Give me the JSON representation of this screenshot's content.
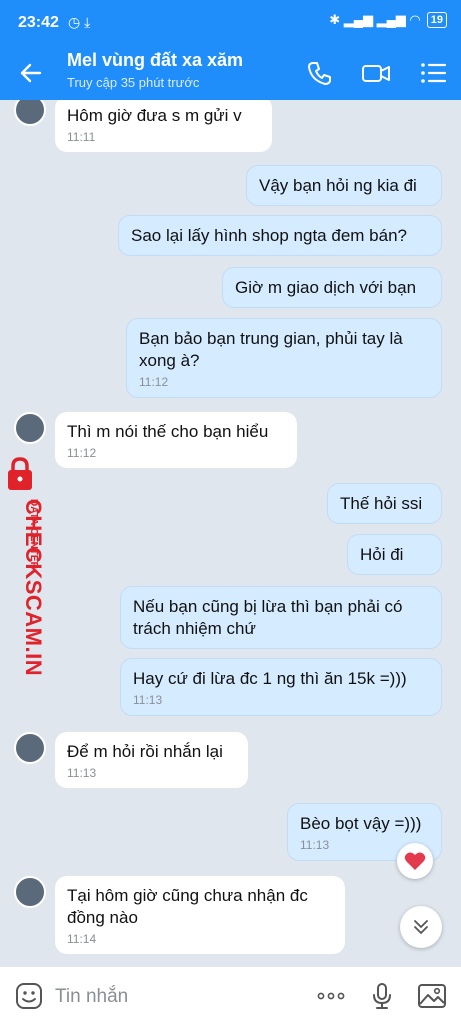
{
  "status": {
    "time": "23:42",
    "left_icons": "◷ ⤓",
    "battery": "19",
    "right_icons": "✱ ▂▄▆ ▂▄▆ ◠"
  },
  "header": {
    "title": "Mel vùng đất xa xăm",
    "subtitle": "Truy cập 35 phút trước"
  },
  "messages": [
    {
      "dir": "in",
      "text": "Hôm giờ đưa s m gửi v",
      "time": "11:11"
    },
    {
      "dir": "out",
      "text": "Vậy bạn hỏi ng kia đi",
      "time": ""
    },
    {
      "dir": "out",
      "text": "Sao lại lấy hình shop ngta đem bán?",
      "time": ""
    },
    {
      "dir": "out",
      "text": "Giờ m giao dịch với bạn",
      "time": ""
    },
    {
      "dir": "out",
      "text": "Bạn bảo bạn trung gian, phủi tay là xong à?",
      "time": "11:12"
    },
    {
      "dir": "in",
      "text": "Thì m nói thế cho bạn hiểu",
      "time": "11:12"
    },
    {
      "dir": "out",
      "text": "Thế hỏi ssi",
      "time": ""
    },
    {
      "dir": "out",
      "text": "Hỏi đi",
      "time": ""
    },
    {
      "dir": "out",
      "text": "Nếu bạn cũng bị lừa thì bạn phải có trách nhiệm chứ",
      "time": ""
    },
    {
      "dir": "out",
      "text": "Hay cứ đi lừa đc 1 ng thì ăn 15k =)))",
      "time": "11:13"
    },
    {
      "dir": "in",
      "text": "Để m hỏi rồi nhắn lại",
      "time": "11:13"
    },
    {
      "dir": "out",
      "text": "Bèo bọt vậy =)))",
      "time": "11:13"
    },
    {
      "dir": "in",
      "text": "Tại hôm giờ cũng chưa nhận đc đồng nào",
      "time": "11:14"
    }
  ],
  "watermark": {
    "brand": "CHECKSCAM.INFO",
    "tag": "DATA CENTER"
  },
  "input": {
    "placeholder": "Tin nhắn"
  },
  "colors": {
    "header": "#1f8efb",
    "out_bubble": "#d5ebff",
    "in_bubble": "#ffffff",
    "background": "#dfe6ee",
    "watermark": "#e0222a"
  },
  "icons": [
    "back-arrow-icon",
    "phone-icon",
    "video-call-icon",
    "menu-list-icon",
    "sticker-icon",
    "more-dots-icon",
    "microphone-icon",
    "image-icon",
    "heart-icon",
    "chevron-double-down-icon"
  ]
}
